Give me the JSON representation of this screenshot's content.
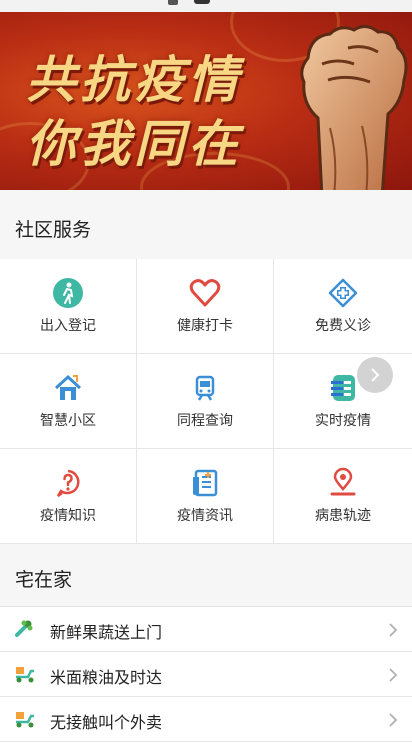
{
  "banner": {
    "line1": "共抗疫情",
    "line2": "你我同在"
  },
  "community": {
    "title": "社区服务",
    "items": [
      {
        "label": "出入登记",
        "icon": "person-walking-icon"
      },
      {
        "label": "健康打卡",
        "icon": "heart-icon"
      },
      {
        "label": "免费义诊",
        "icon": "medical-cross-icon"
      },
      {
        "label": "智慧小区",
        "icon": "house-icon"
      },
      {
        "label": "同程查询",
        "icon": "train-icon"
      },
      {
        "label": "实时疫情",
        "icon": "list-icon"
      },
      {
        "label": "疫情知识",
        "icon": "question-icon"
      },
      {
        "label": "疫情资讯",
        "icon": "news-icon"
      },
      {
        "label": "病患轨迹",
        "icon": "location-pin-icon"
      }
    ]
  },
  "home": {
    "title": "宅在家",
    "items": [
      {
        "label": "新鲜果蔬送上门",
        "icon": "vegetable-icon"
      },
      {
        "label": "米面粮油及时达",
        "icon": "delivery-scooter-icon"
      },
      {
        "label": "无接触叫个外卖",
        "icon": "delivery-scooter-icon"
      }
    ]
  },
  "colors": {
    "banner_red": "#b92d14",
    "banner_gold": "#f7d784",
    "teal": "#3fb8a3",
    "red": "#e04a3f",
    "blue": "#3a8fd6"
  }
}
